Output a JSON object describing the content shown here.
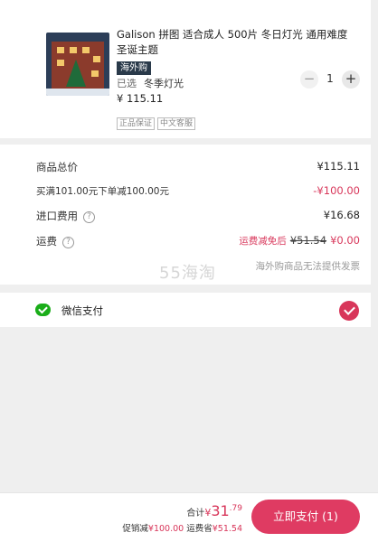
{
  "product": {
    "title": "Galison 拼图 适合成人 500片 冬日灯光 通用难度 圣诞主题",
    "overseas_tag": "海外购",
    "chosen_label": "已选",
    "chosen_value": "冬季灯光",
    "price": "¥ 115.11",
    "quantity": "1",
    "minus_symbol": "−",
    "plus_symbol": "+",
    "badges": [
      "正品保证",
      "中文客服"
    ]
  },
  "summary": {
    "goods_total_label": "商品总价",
    "goods_total_value": "¥115.11",
    "promo_label": "买满101.00元下单减100.00元",
    "promo_value": "-¥100.00",
    "import_fee_label": "进口费用",
    "import_fee_value": "¥16.68",
    "shipping_label": "运费",
    "shipping_waived": "运费减免后",
    "shipping_original": "¥51.54",
    "shipping_value": "¥0.00",
    "help_symbol": "?",
    "watermark": "55海淘",
    "invoice_notice": "海外购商品无法提供发票"
  },
  "payment": {
    "method_label": "微信支付",
    "icon": "wechat-pay-icon",
    "selected": true
  },
  "footer": {
    "total_prefix": "合计",
    "total_currency": "¥",
    "total_integer": "31",
    "total_decimal": ".79",
    "discount_label": "促销减",
    "discount_value": "¥100.00",
    "shipping_saved_label": "运费省",
    "shipping_saved_value": "¥51.54",
    "pay_button": "立即支付 (1)"
  },
  "colors": {
    "accent": "#df3b62",
    "wechat_green": "#1aad19",
    "tag_bg": "#2a3a4a"
  }
}
